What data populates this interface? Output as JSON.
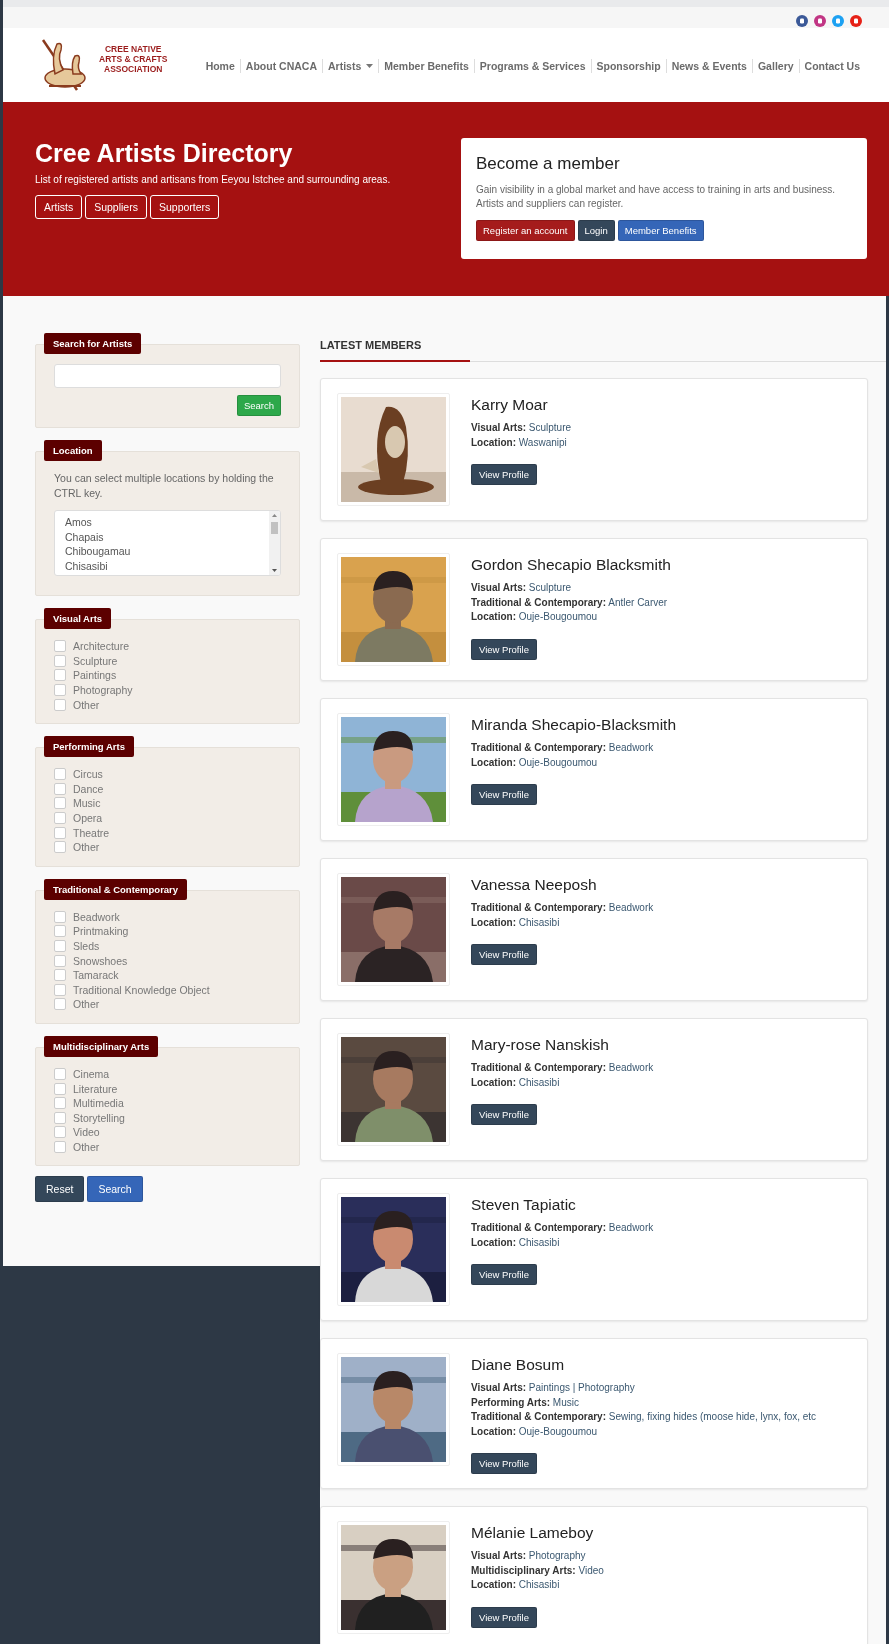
{
  "logo": {
    "lines": [
      "CREE NATIVE",
      "ARTS & CRAFTS",
      "ASSOCIATION"
    ]
  },
  "nav": [
    {
      "label": "Home",
      "dropdown": false
    },
    {
      "label": "About CNACA",
      "dropdown": false
    },
    {
      "label": "Artists",
      "dropdown": true
    },
    {
      "label": "Member Benefits",
      "dropdown": false
    },
    {
      "label": "Programs & Services",
      "dropdown": false
    },
    {
      "label": "Sponsorship",
      "dropdown": false
    },
    {
      "label": "News & Events",
      "dropdown": false
    },
    {
      "label": "Gallery",
      "dropdown": false
    },
    {
      "label": "Contact Us",
      "dropdown": false
    }
  ],
  "hero": {
    "title": "Cree Artists Directory",
    "subtitle": "List of registered artists and artisans from Eeyou Istchee and surrounding areas.",
    "buttons": [
      "Artists",
      "Suppliers",
      "Supporters"
    ]
  },
  "member_box": {
    "title": "Become a member",
    "text": "Gain visibility in a global market and have access to training in arts and business. Artists and suppliers can register.",
    "buttons": [
      {
        "label": "Register an account",
        "kind": "register"
      },
      {
        "label": "Login",
        "kind": "login"
      },
      {
        "label": "Member Benefits",
        "kind": "benefits"
      }
    ]
  },
  "sidebar": {
    "search": {
      "title": "Search for Artists",
      "button": "Search"
    },
    "location": {
      "title": "Location",
      "hint": "You can select multiple locations by holding the CTRL key.",
      "options": [
        "Amos",
        "Chapais",
        "Chibougamau",
        "Chisasibi"
      ]
    },
    "groups": [
      {
        "title": "Visual Arts",
        "options": [
          {
            "label": "Architecture",
            "checked": false
          },
          {
            "label": "Sculpture",
            "checked": false
          },
          {
            "label": "Paintings",
            "checked": false
          },
          {
            "label": "Photography",
            "checked": false
          },
          {
            "label": "Other",
            "checked": false
          }
        ]
      },
      {
        "title": "Performing Arts",
        "options": [
          {
            "label": "Circus",
            "checked": false
          },
          {
            "label": "Dance",
            "checked": false
          },
          {
            "label": "Music",
            "checked": false
          },
          {
            "label": "Opera",
            "checked": false
          },
          {
            "label": "Theatre",
            "checked": false
          },
          {
            "label": "Other",
            "checked": false
          }
        ]
      },
      {
        "title": "Traditional & Contemporary",
        "options": [
          {
            "label": "Beadwork",
            "checked": false
          },
          {
            "label": "Printmaking",
            "checked": false
          },
          {
            "label": "Sleds",
            "checked": false
          },
          {
            "label": "Snowshoes",
            "checked": false
          },
          {
            "label": "Tamarack",
            "checked": false
          },
          {
            "label": "Traditional Knowledge Object",
            "checked": false
          },
          {
            "label": "Other",
            "checked": false
          }
        ]
      },
      {
        "title": "Multidisciplinary Arts",
        "options": [
          {
            "label": "Cinema",
            "checked": false
          },
          {
            "label": "Literature",
            "checked": false
          },
          {
            "label": "Multimedia",
            "checked": false
          },
          {
            "label": "Storytelling",
            "checked": false
          },
          {
            "label": "Video",
            "checked": false
          },
          {
            "label": "Other",
            "checked": false
          }
        ]
      }
    ],
    "buttons": [
      {
        "label": "Reset",
        "kind": "reset"
      },
      {
        "label": "Search",
        "kind": "search"
      }
    ]
  },
  "members_heading": "LATEST MEMBERS",
  "members": [
    {
      "name": "Karry Moar",
      "fields": [
        {
          "label": "Visual Arts:",
          "value": "Sculpture"
        },
        {
          "label": "Location:",
          "value": "Waswanipi"
        }
      ],
      "button": "View Profile"
    },
    {
      "name": "Gordon Shecapio Blacksmith",
      "fields": [
        {
          "label": "Visual Arts:",
          "value": "Sculpture"
        },
        {
          "label": "Traditional & Contemporary:",
          "value": "Antler Carver"
        },
        {
          "label": "Location:",
          "value": "Ouje-Bougoumou"
        }
      ],
      "button": "View Profile"
    },
    {
      "name": "Miranda Shecapio-Blacksmith",
      "fields": [
        {
          "label": "Traditional & Contemporary:",
          "value": "Beadwork"
        },
        {
          "label": "Location:",
          "value": "Ouje-Bougoumou"
        }
      ],
      "button": "View Profile"
    },
    {
      "name": "Vanessa Neeposh",
      "fields": [
        {
          "label": "Traditional & Contemporary:",
          "value": "Beadwork"
        },
        {
          "label": "Location:",
          "value": "Chisasibi"
        }
      ],
      "button": "View Profile"
    },
    {
      "name": "Mary-rose Nanskish",
      "fields": [
        {
          "label": "Traditional & Contemporary:",
          "value": "Beadwork"
        },
        {
          "label": "Location:",
          "value": "Chisasibi"
        }
      ],
      "button": "View Profile"
    },
    {
      "name": "Steven Tapiatic",
      "fields": [
        {
          "label": "Traditional & Contemporary:",
          "value": "Beadwork"
        },
        {
          "label": "Location:",
          "value": "Chisasibi"
        }
      ],
      "button": "View Profile"
    },
    {
      "name": "Diane Bosum",
      "fields": [
        {
          "label": "Visual Arts:",
          "value": "Paintings | Photography"
        },
        {
          "label": "Performing Arts:",
          "value": "Music"
        },
        {
          "label": "Traditional & Contemporary:",
          "value": "Sewing, fixing hides (moose hide, lynx, fox, etc"
        },
        {
          "label": "Location:",
          "value": "Ouje-Bougoumou"
        }
      ],
      "button": "View Profile"
    },
    {
      "name": "Mélanie Lameboy",
      "fields": [
        {
          "label": "Visual Arts:",
          "value": "Photography"
        },
        {
          "label": "Multidisciplinary Arts:",
          "value": "Video"
        },
        {
          "label": "Location:",
          "value": "Chisasibi"
        }
      ],
      "button": "View Profile"
    }
  ]
}
